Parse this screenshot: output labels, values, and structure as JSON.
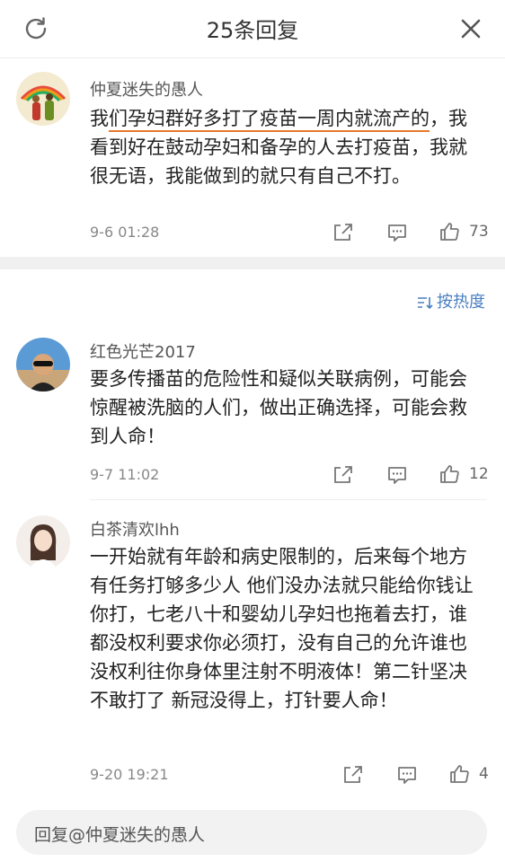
{
  "header": {
    "title": "25条回复",
    "refresh_icon": "refresh-icon",
    "close_icon": "close-icon"
  },
  "main_comment": {
    "author": "仲夏迷失的愚人",
    "text_prefix": "我",
    "text_underlined": "们孕妇群好多打了疫苗一周内就流产的",
    "text_rest": "，我看到好在鼓动孕妇和备孕的人去打疫苗，我就很无语，我能做到的就只有自己不打。",
    "time": "9-6 01:28",
    "likes": "73"
  },
  "sort_label": "按热度",
  "replies": [
    {
      "author": "红色光芒2017",
      "text": "要多传播苗的危险性和疑似关联病例，可能会惊醒被洗脑的人们，做出正确选择，可能会救到人命！",
      "time": "9-7 11:02",
      "likes": "12"
    },
    {
      "author": "白茶清欢lhh",
      "text": "一开始就有年龄和病史限制的，后来每个地方有任务打够多少人 他们没办法就只能给你钱让你打，七老八十和婴幼儿孕妇也拖着去打，谁都没权利要求你必须打，没有自己的允许谁也没权利往你身体里注射不明液体！第二针坚决不敢打了 新冠没得上，打针要人命！",
      "time": "9-20 19:21",
      "likes": "4"
    }
  ],
  "reply_input": {
    "placeholder": "回复@仲夏迷失的愚人"
  },
  "colors": {
    "accent_link": "#4a7fc1",
    "underline": "#e8772a"
  }
}
